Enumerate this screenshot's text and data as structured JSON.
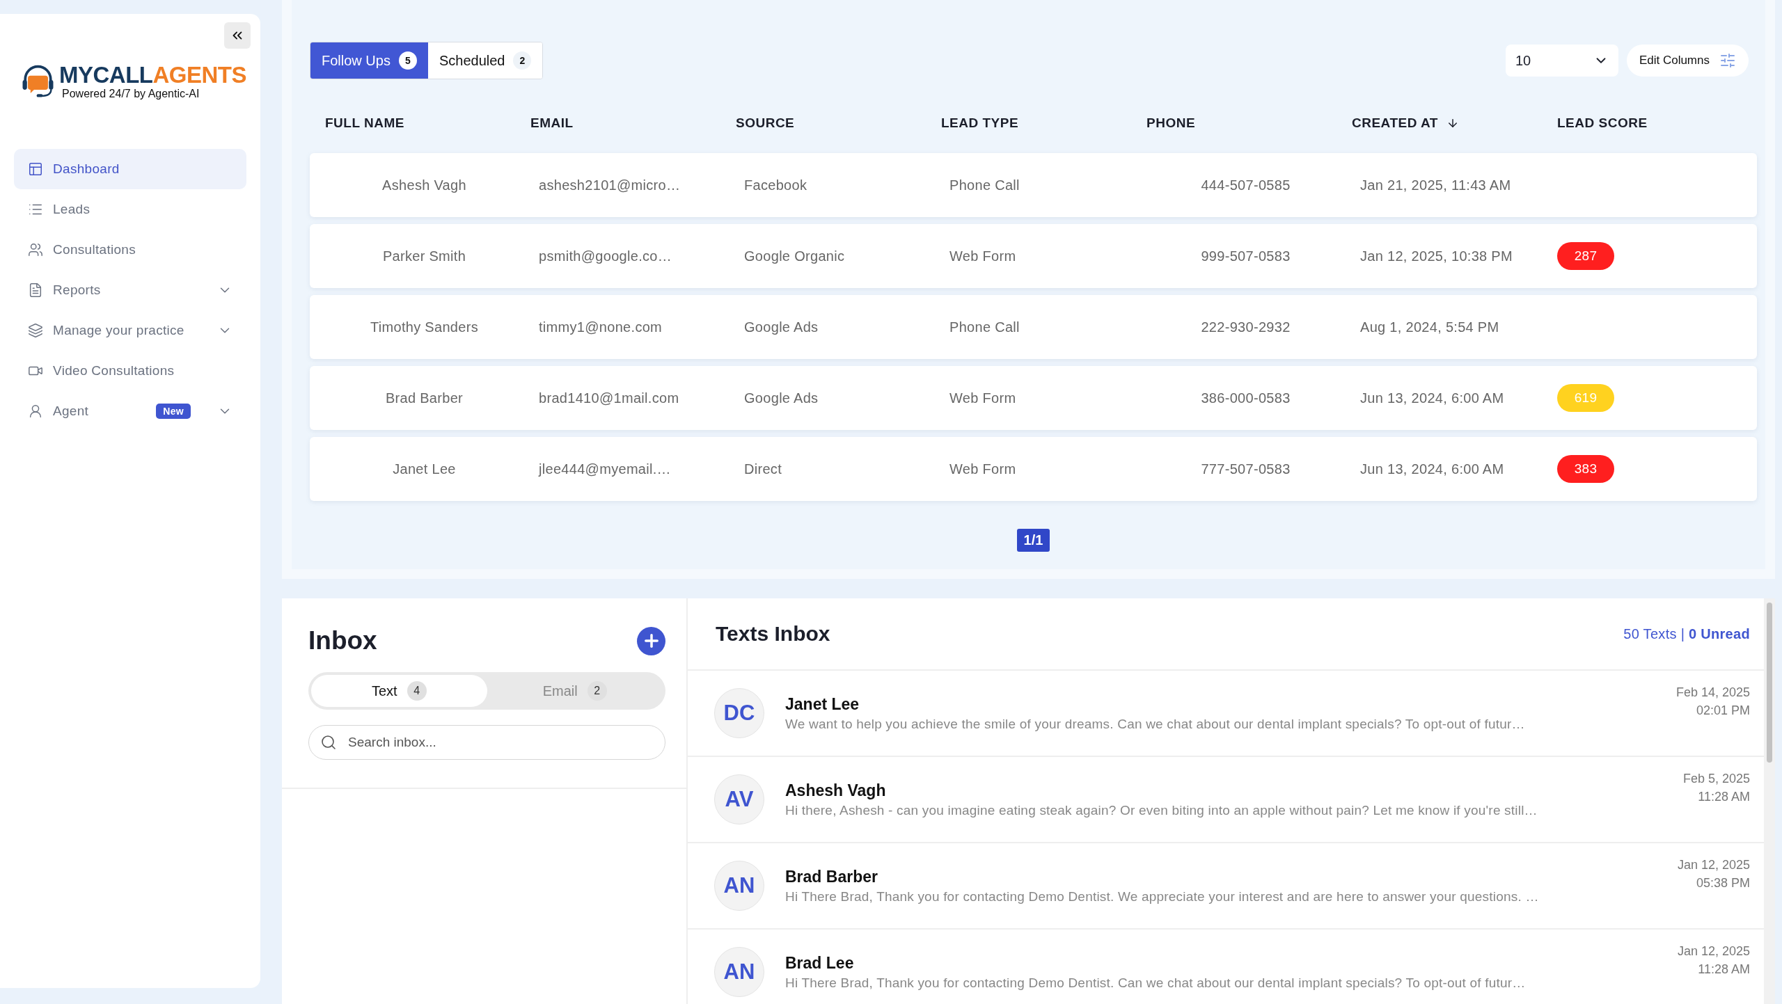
{
  "sidebar": {
    "logo": {
      "dark": "MYCALL",
      "accent": "AGENTS",
      "tagline": "Powered 24/7 by Agentic-AI"
    },
    "items": [
      {
        "kind": "dashboard",
        "label": "Dashboard",
        "selected": true
      },
      {
        "kind": "list",
        "label": "Leads",
        "selected": false
      },
      {
        "kind": "users",
        "label": "Consultations",
        "selected": false
      },
      {
        "kind": "file",
        "label": "Reports",
        "selected": false,
        "expandable": true
      },
      {
        "kind": "layers",
        "label": "Manage your practice",
        "selected": false,
        "expandable": true
      },
      {
        "kind": "video",
        "label": "Video Consultations",
        "selected": false
      },
      {
        "kind": "agent",
        "label": "Agent",
        "selected": false,
        "expandable": true,
        "badge": "New"
      }
    ]
  },
  "leads": {
    "tabs": [
      {
        "label": "Follow Ups",
        "count": "5",
        "selected": true
      },
      {
        "label": "Scheduled",
        "count": "2",
        "selected": false
      }
    ],
    "page_size": "10",
    "edit_columns": "Edit Columns",
    "table": {
      "columns": [
        {
          "label": "FULL NAME"
        },
        {
          "label": "EMAIL"
        },
        {
          "label": "SOURCE"
        },
        {
          "label": "LEAD TYPE"
        },
        {
          "label": "PHONE"
        },
        {
          "label": "CREATED AT",
          "sorted": true
        },
        {
          "label": "LEAD SCORE"
        }
      ],
      "rows": [
        {
          "name": "Ashesh Vagh",
          "email": "ashesh2101@micro…",
          "source": "Facebook",
          "lead_type": "Phone Call",
          "phone": "444-507-0585",
          "created_at": "Jan 21, 2025, 11:43 AM"
        },
        {
          "name": "Parker Smith",
          "email": "psmith@google.co…",
          "source": "Google Organic",
          "lead_type": "Web Form",
          "phone": "999-507-0583",
          "created_at": "Jan 12, 2025, 10:38 PM",
          "score": {
            "value": "287",
            "color": "#ff1f1f"
          }
        },
        {
          "name": "Timothy Sanders",
          "email": "timmy1@none.com",
          "source": "Google Ads",
          "lead_type": "Phone Call",
          "phone": "222-930-2932",
          "created_at": "Aug 1, 2024, 5:54 PM"
        },
        {
          "name": "Brad Barber",
          "email": "brad1410@1mail.com",
          "source": "Google Ads",
          "lead_type": "Web Form",
          "phone": "386-000-0583",
          "created_at": "Jun 13, 2024, 6:00 AM",
          "score": {
            "value": "619",
            "color": "#ffd21f"
          }
        },
        {
          "name": "Janet Lee",
          "email": "jlee444@myemail.…",
          "source": "Direct",
          "lead_type": "Web Form",
          "phone": "777-507-0583",
          "created_at": "Jun 13, 2024, 6:00 AM",
          "score": {
            "value": "383",
            "color": "#ff1f1f"
          }
        }
      ]
    },
    "pagination": "1/1"
  },
  "inbox": {
    "title": "Inbox",
    "toggle": [
      {
        "label": "Text",
        "count": "4",
        "selected": true
      },
      {
        "label": "Email",
        "count": "2",
        "selected": false
      }
    ],
    "search": {
      "placeholder": "Search inbox..."
    }
  },
  "texts_inbox": {
    "title": "Texts Inbox",
    "summary": "50 Texts | **0 Unread**",
    "messages": [
      {
        "initials": "DC",
        "name": "Janet Lee",
        "preview": "We want to help you achieve the smile of your dreams. Can we chat about our dental implant specials? To opt-out of futur…",
        "date": "Feb 14, 2025",
        "time": "02:01 PM"
      },
      {
        "initials": "AV",
        "name": "Ashesh Vagh",
        "preview": "Hi there, Ashesh - can you imagine eating steak again? Or even biting into an apple without pain? Let me know if you're still…",
        "date": "Feb 5, 2025",
        "time": "11:28 AM"
      },
      {
        "initials": "AN",
        "name": "Brad Barber",
        "preview": "Hi There Brad, Thank you for contacting Demo Dentist. We appreciate your interest and are here to answer your questions. …",
        "date": "Jan 12, 2025",
        "time": "05:38 PM"
      },
      {
        "initials": "AN",
        "name": "Brad Lee",
        "preview": "Hi There Brad, Thank you for contacting Demo Dentist. Can we chat about our dental implant specials? To opt-out of futur…",
        "date": "Jan 12, 2025",
        "time": "11:28 AM"
      }
    ]
  }
}
